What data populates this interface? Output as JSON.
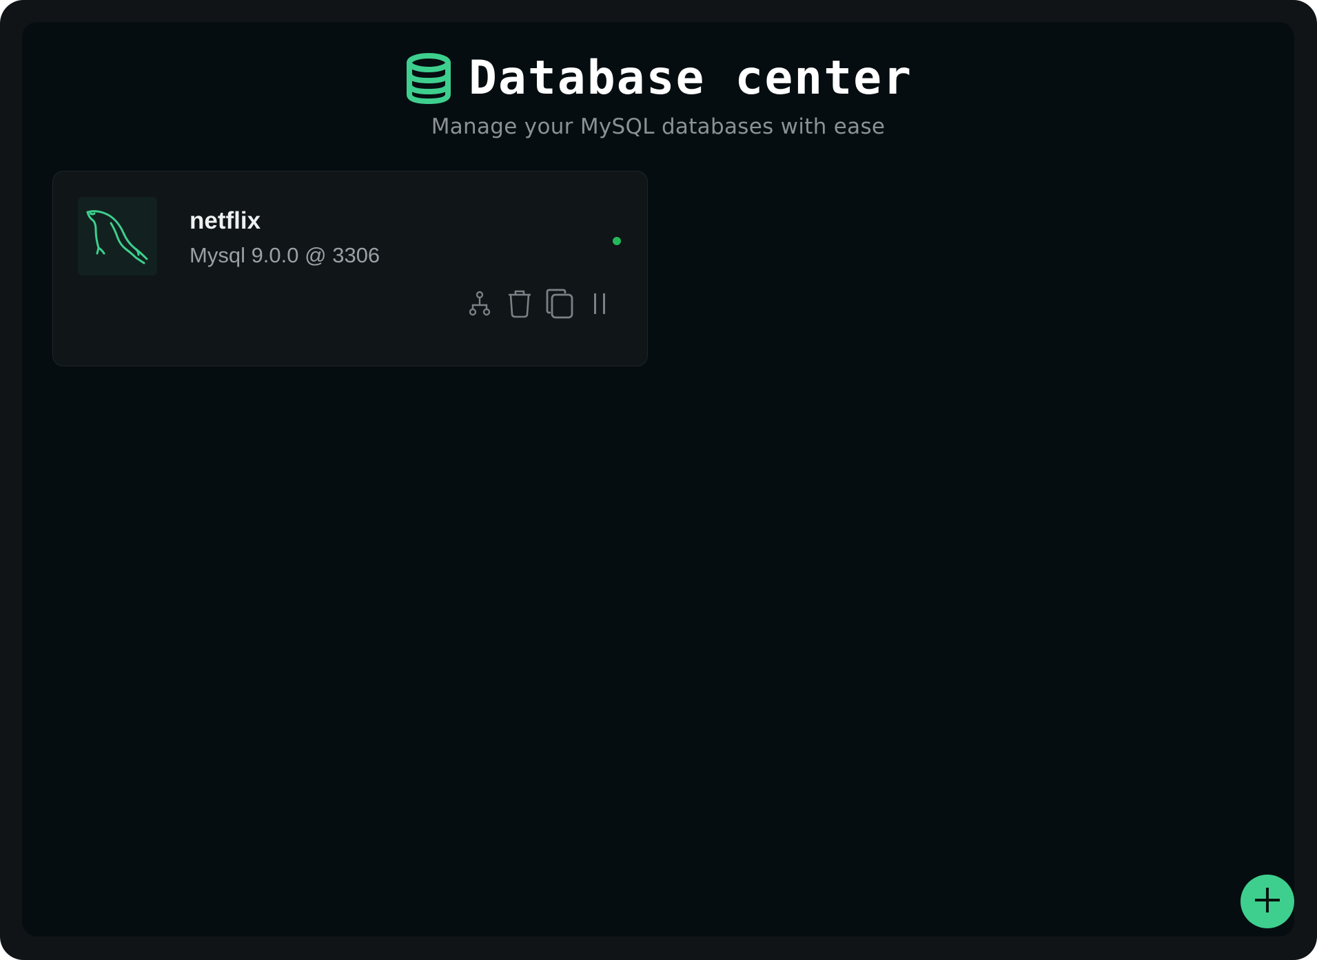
{
  "header": {
    "title": "Database center",
    "subtitle": "Manage your MySQL databases with ease",
    "icon": "database-icon"
  },
  "databases": [
    {
      "name": "netflix",
      "meta": "Mysql 9.0.0 @ 3306",
      "status": "running",
      "status_color": "#23b95a",
      "logo": "mysql-dolphin-icon",
      "actions": [
        "sitemap-icon",
        "trash-icon",
        "copy-icon",
        "pause-icon"
      ]
    }
  ],
  "fab": {
    "icon": "plus-icon"
  },
  "colors": {
    "accent": "#3ecf8e",
    "background": "#060d10",
    "card": "#101518",
    "status_running": "#23b95a"
  }
}
